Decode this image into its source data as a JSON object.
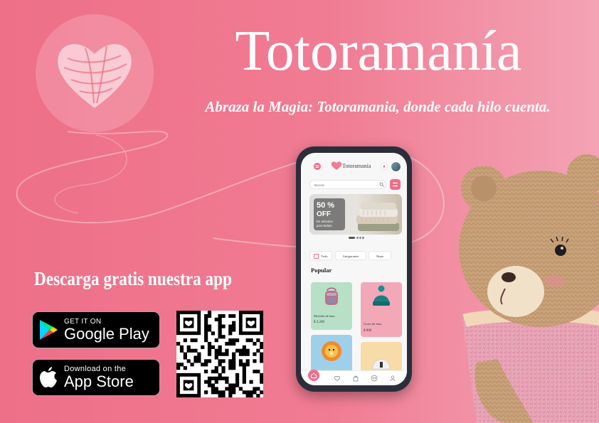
{
  "brand": {
    "title": "Totoramanía",
    "tagline": "Abraza la Magia: Totoramania, donde cada hilo cuenta."
  },
  "download": {
    "heading": "Descarga gratis nuestra app",
    "google_small": "GET IT ON",
    "google_big": "Google Play",
    "apple_small": "Download on the",
    "apple_big": "App Store"
  },
  "app": {
    "name": "Totoramanía",
    "search_placeholder": "Buscar",
    "banner": {
      "percent": "50 %",
      "off": "OFF",
      "line1": "En artículos",
      "line2": "para bebés"
    },
    "chips": [
      "Todo",
      "Amigurumis",
      "Ropa"
    ],
    "section_title": "Popular",
    "products": [
      {
        "name": "Mochila de lana",
        "price": "$ 3.200"
      },
      {
        "name": "Gorro de lana",
        "price": "$ 900"
      }
    ]
  },
  "colors": {
    "background": "#ee6f88",
    "accent": "#f06d88",
    "phone": "#2b2d3a"
  },
  "icons": [
    "yarn-heart-logo-icon",
    "google-play-icon",
    "apple-icon",
    "qr-code",
    "home-icon",
    "heart-icon",
    "bag-icon",
    "cart-icon",
    "user-icon"
  ]
}
